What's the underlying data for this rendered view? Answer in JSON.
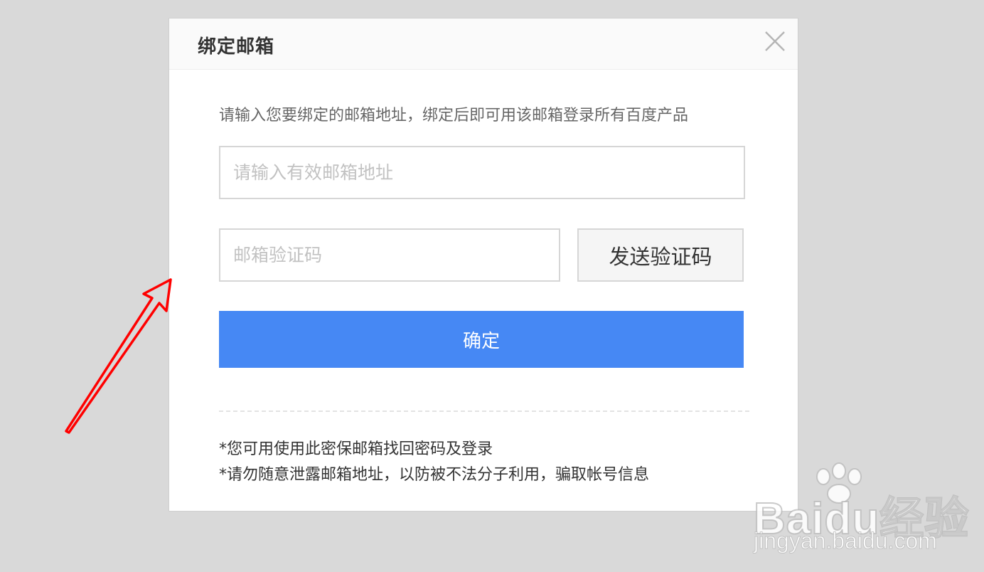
{
  "dialog": {
    "title": "绑定邮箱",
    "description": "请输入您要绑定的邮箱地址，绑定后即可用该邮箱登录所有百度产品",
    "email_input": {
      "placeholder": "请输入有效邮箱地址",
      "value": ""
    },
    "code_input": {
      "placeholder": "邮箱验证码",
      "value": ""
    },
    "send_code_label": "发送验证码",
    "confirm_label": "确定",
    "tips": [
      "*您可用使用此密保邮箱找回密码及登录",
      "*请勿随意泄露邮箱地址，以防被不法分子利用，骗取帐号信息"
    ]
  },
  "watermark": {
    "logo_text": "Baidu经验",
    "url_text": "jingyan.baidu.com"
  },
  "colors": {
    "background": "#d9d9d9",
    "primary_button": "#4688f4",
    "annotation_arrow": "#ff0000"
  },
  "icons": {
    "close": "close-icon",
    "arrow": "red-arrow-icon",
    "paw": "paw-icon"
  }
}
